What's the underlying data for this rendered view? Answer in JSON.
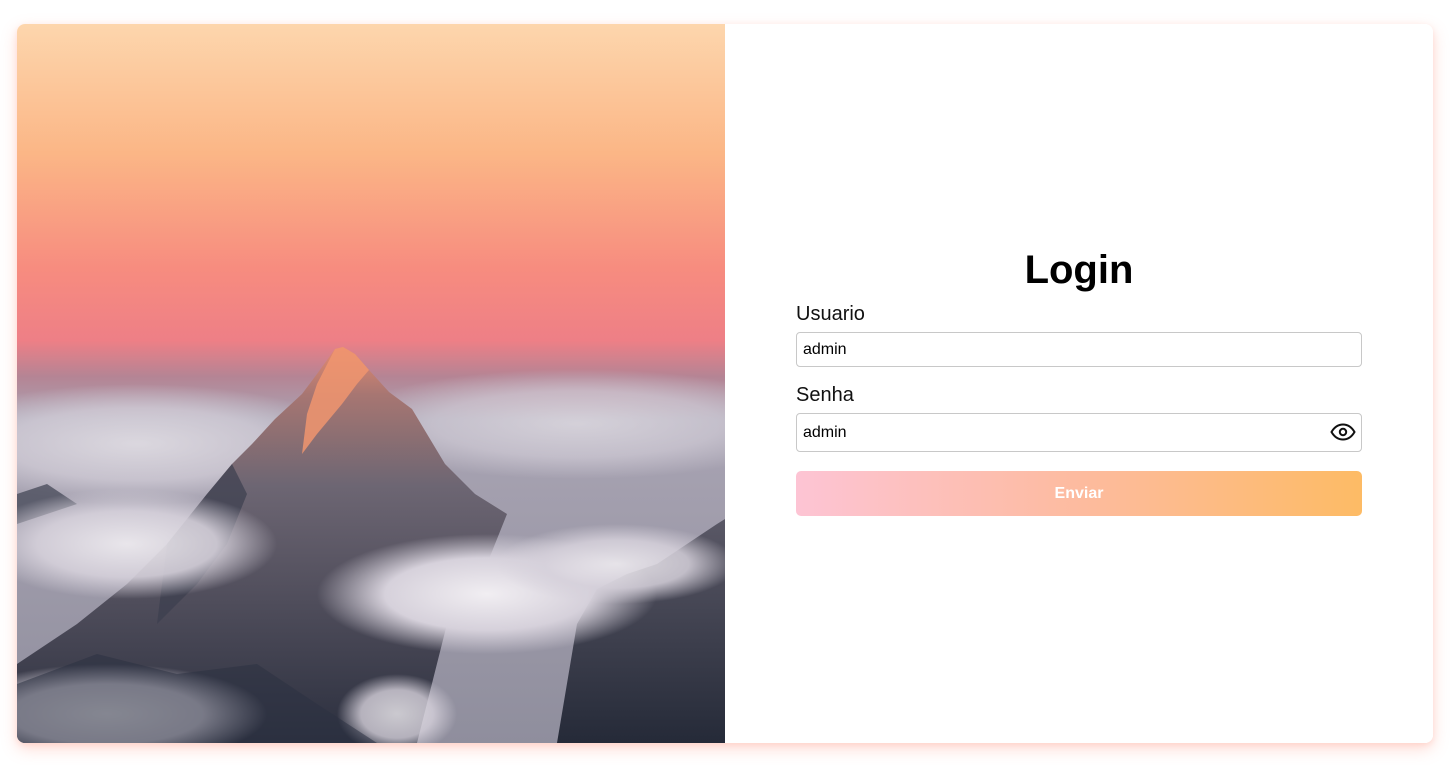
{
  "login": {
    "title": "Login",
    "username_label": "Usuario",
    "username_value": "admin",
    "password_label": "Senha",
    "password_value": "admin",
    "submit_label": "Enviar",
    "password_toggle_icon": "eye-icon"
  },
  "hero": {
    "icon": "mountain-peak-above-clouds-photo"
  },
  "colors": {
    "button_gradient_start": "#fdc4d4",
    "button_gradient_end": "#fdbb65",
    "card_shadow": "#ff8c78",
    "sky_top": "#fdd3a8",
    "sky_mid": "#f68a7f"
  }
}
